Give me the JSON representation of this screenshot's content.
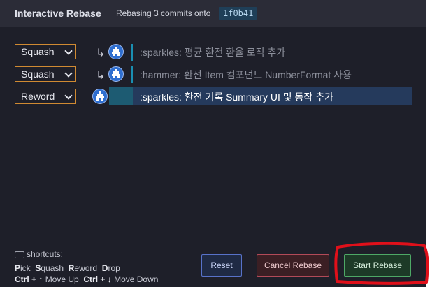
{
  "header": {
    "title": "Interactive Rebase",
    "subtitle": "Rebasing 3 commits onto",
    "onto_hash": "1f0b41"
  },
  "commits": [
    {
      "action": "Squash",
      "message": ":sparkles: 평균 환전 환율 로직 추가",
      "squash_indicator": "↳",
      "active": false
    },
    {
      "action": "Squash",
      "message": ":hammer: 환전 Item 컴포넌트 NumberFormat 사용",
      "squash_indicator": "↳",
      "active": false
    },
    {
      "action": "Reword",
      "message": ":sparkles: 환전 기록 Summary UI 및 동작 추가",
      "active": true
    }
  ],
  "shortcuts": {
    "heading": "shortcuts:",
    "actions": [
      {
        "key": "P",
        "rest": "ick"
      },
      {
        "key": "S",
        "rest": "quash"
      },
      {
        "key": "R",
        "rest": "eword"
      },
      {
        "key": "D",
        "rest": "rop"
      }
    ],
    "move_up": {
      "combo": "Ctrl + ↑",
      "label": "Move Up"
    },
    "move_down": {
      "combo": "Ctrl + ↓",
      "label": "Move Down"
    }
  },
  "buttons": {
    "reset": "Reset",
    "cancel": "Cancel Rebase",
    "start": "Start Rebase"
  },
  "colors": {
    "background": "#1e1f29",
    "select_border": "#d08a32",
    "highlight": "#253a5c",
    "annotation": "#e0101a"
  }
}
